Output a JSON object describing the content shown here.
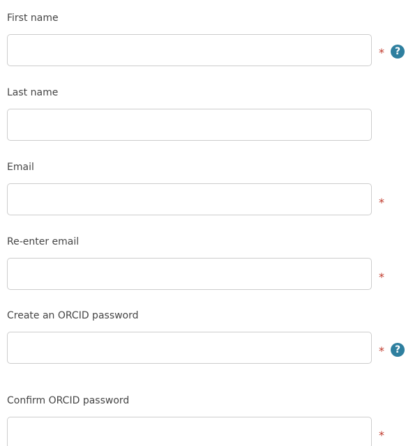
{
  "form": {
    "fields": [
      {
        "label": "First name",
        "value": "",
        "required": "*",
        "help_icon": "question-circle-icon"
      },
      {
        "label": "Last name",
        "value": ""
      },
      {
        "label": "Email",
        "value": "",
        "required": "*"
      },
      {
        "label": "Re-enter email",
        "value": "",
        "required": "*"
      },
      {
        "label": "Create an ORCID password",
        "value": "",
        "required": "*",
        "help_icon": "question-circle-icon"
      },
      {
        "label": "Confirm ORCID password",
        "value": "",
        "required": "*"
      }
    ],
    "help_glyph": "?"
  },
  "colors": {
    "label_text": "#444444",
    "input_border": "#cccccc",
    "required_star": "#c0392b",
    "help_icon_bg": "#2e7f9f"
  }
}
